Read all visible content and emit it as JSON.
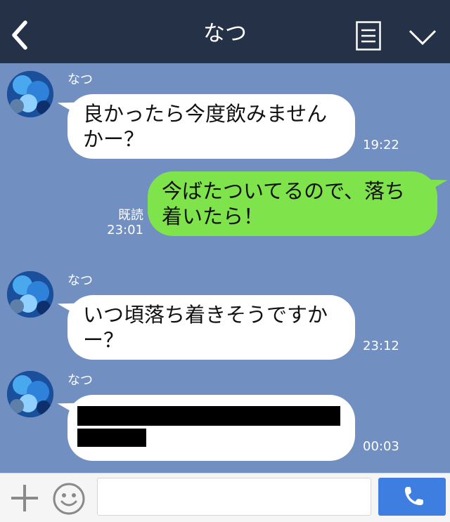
{
  "header": {
    "title": "なつ"
  },
  "icons": {
    "back": "chevron-left-icon",
    "menu": "list-icon",
    "collapse": "chevron-down-icon",
    "add": "plus-icon",
    "emoji": "smiley-icon",
    "call": "phone-icon"
  },
  "messages": [
    {
      "sender": "なつ",
      "line1": "良かったら今度飲みません",
      "line2": "かー？",
      "time": "19:22"
    },
    {
      "line1": "今ばたついてるので、落ち",
      "line2": "着いたら！",
      "read_label": "既読",
      "time": "23:01"
    },
    {
      "sender": "なつ",
      "line1": "いつ頃落ち着きそうですか",
      "line2": "ー？",
      "time": "23:12"
    },
    {
      "sender": "なつ",
      "time": "00:03",
      "redacted": true
    }
  ],
  "input": {
    "value": "",
    "placeholder": ""
  },
  "colors": {
    "header": "#243147",
    "background": "#7190c1",
    "incoming": "#ffffff",
    "outgoing": "#7fe34c",
    "call_button": "#3d7ee0"
  }
}
